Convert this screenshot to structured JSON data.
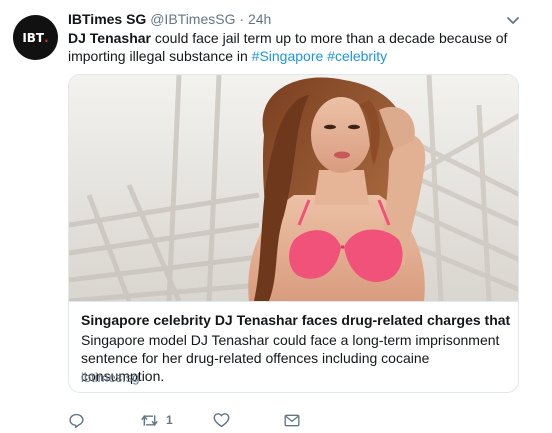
{
  "tweet": {
    "avatar_text": "IBT",
    "author_name": "IBTimes SG",
    "author_handle": "@IBTimesSG",
    "separator": "·",
    "timestamp": "24h",
    "text_mention": "DJ Tenashar",
    "text_body": " could face jail term up to more than a decade because of importing illegal substance in ",
    "hashtag_1": "#Singapore",
    "hashtag_2": "#celebrity"
  },
  "card": {
    "title": "Singapore celebrity DJ Tenashar faces drug-related charges that ...",
    "description": "Singapore model DJ Tenashar could face a long-term imprisonment sentence for her drug-related offences including cocaine consumption.",
    "domain": "ibtimes.sg"
  },
  "actions": {
    "reply_icon": "reply-icon",
    "retweet_icon": "retweet-icon",
    "retweet_count": "1",
    "like_icon": "heart-icon",
    "dm_icon": "envelope-icon"
  },
  "colors": {
    "link_blue": "#1b95e0",
    "secondary_gray": "#657786",
    "border": "#e1e8ed",
    "brand_red": "#e2231a"
  }
}
